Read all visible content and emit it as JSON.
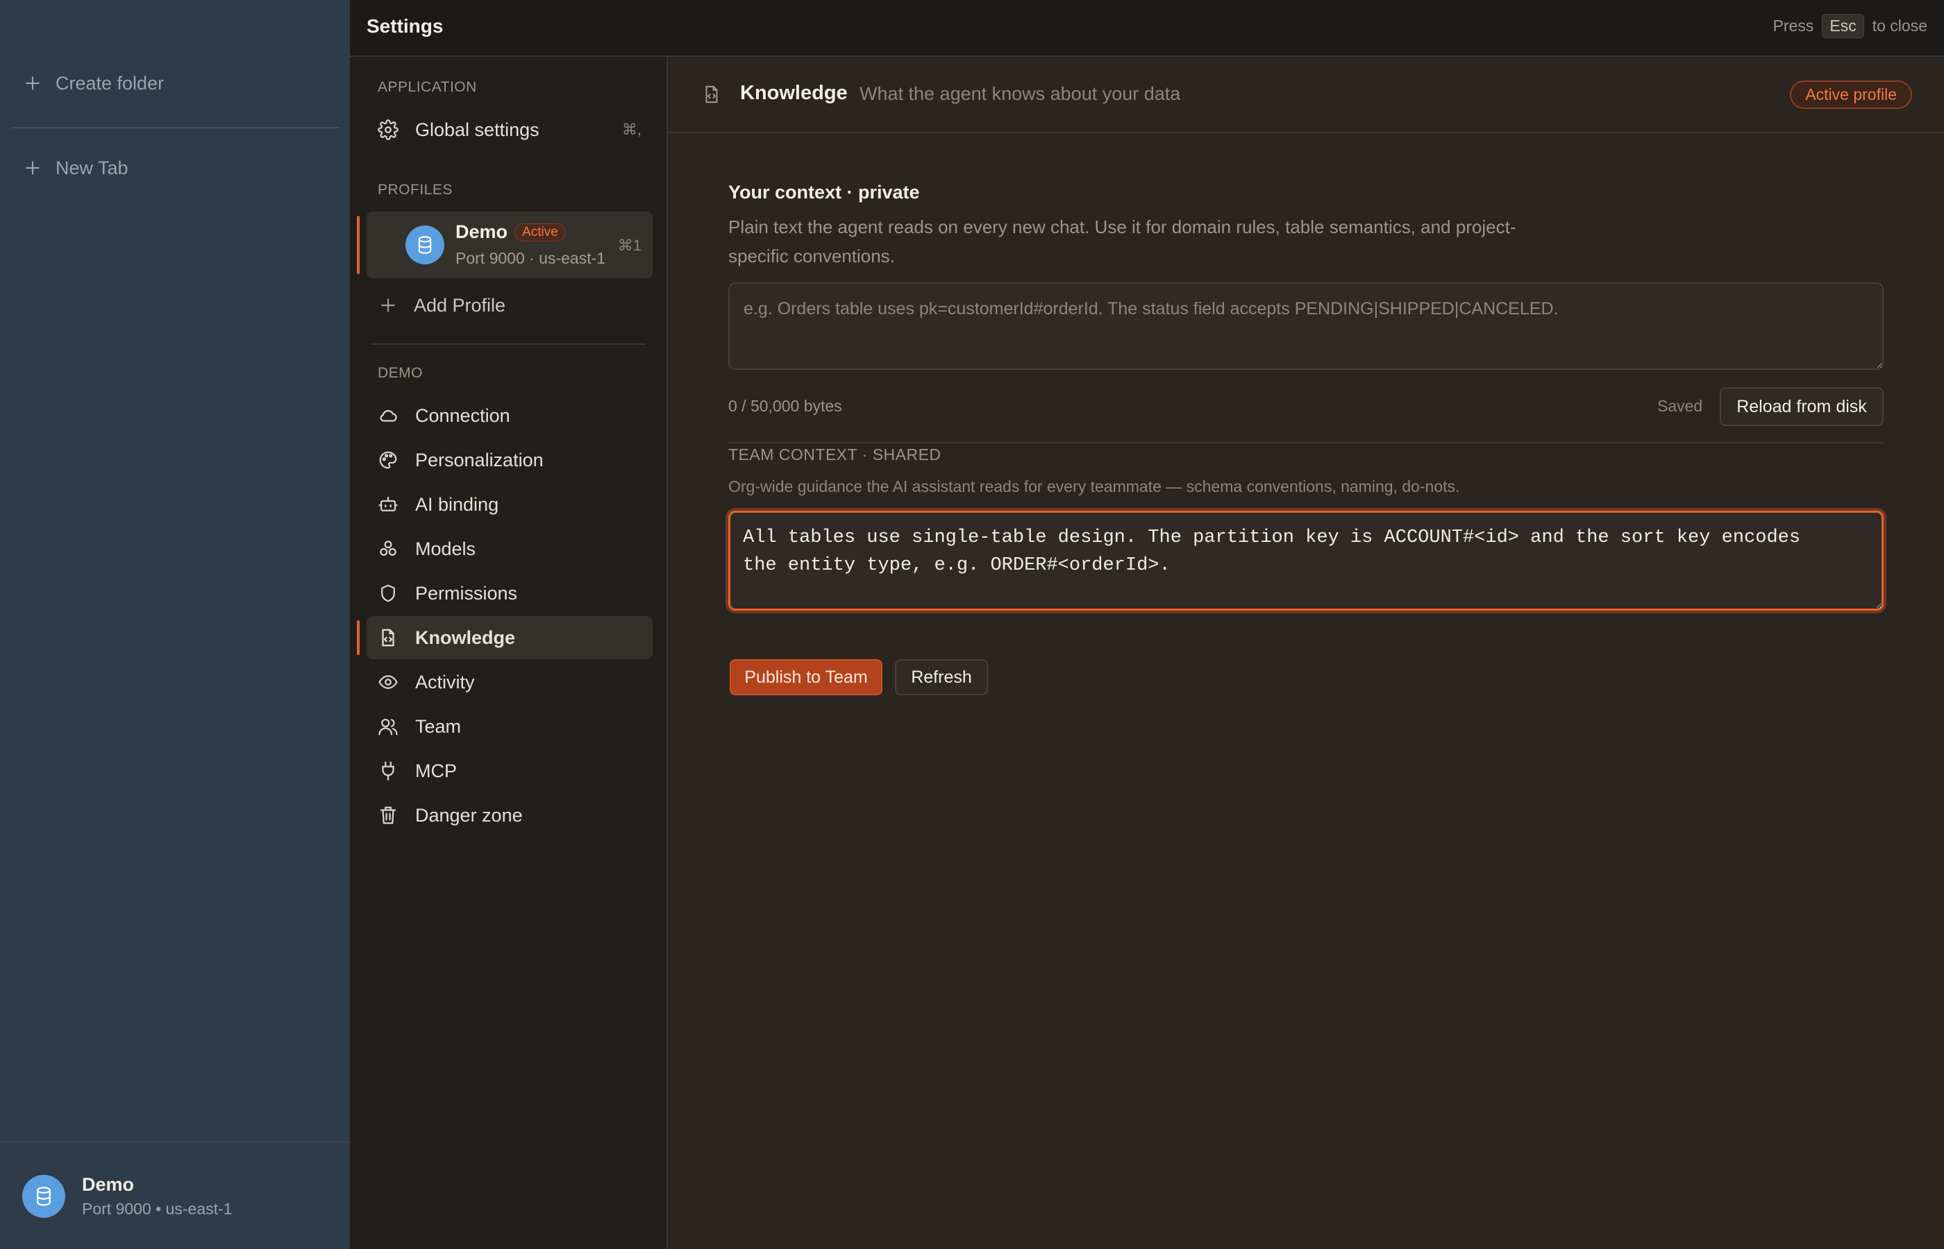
{
  "app_sidebar": {
    "create_folder": "Create folder",
    "new_tab": "New Tab",
    "profile": {
      "name": "Demo",
      "meta": "Port 9000 • us-east-1"
    }
  },
  "top_bar": {
    "title": "Settings",
    "esc_hint": {
      "press": "Press",
      "key": "Esc",
      "suffix": "to close"
    }
  },
  "nav": {
    "application_header": "APPLICATION",
    "global_settings": {
      "label": "Global settings",
      "shortcut": "⌘,"
    },
    "profiles_header": "PROFILES",
    "profile_demo": {
      "name": "Demo",
      "badge": "Active",
      "meta": "Port 9000 · us-east-1",
      "shortcut": "⌘1"
    },
    "add_profile": "Add Profile",
    "demo_header": "DEMO",
    "items": [
      {
        "label": "Connection",
        "icon": "cloud-icon"
      },
      {
        "label": "Personalization",
        "icon": "palette-icon"
      },
      {
        "label": "AI binding",
        "icon": "bot-icon"
      },
      {
        "label": "Models",
        "icon": "models-icon"
      },
      {
        "label": "Permissions",
        "icon": "shield-icon"
      },
      {
        "label": "Knowledge",
        "icon": "file-code-icon",
        "active": true
      },
      {
        "label": "Activity",
        "icon": "eye-icon"
      },
      {
        "label": "Team",
        "icon": "users-icon"
      },
      {
        "label": "MCP",
        "icon": "plug-icon"
      },
      {
        "label": "Danger zone",
        "icon": "trash-icon"
      }
    ]
  },
  "main": {
    "title": "Knowledge",
    "subtitle": "What the agent knows about your data",
    "active_badge": "Active profile",
    "private_context": {
      "label": "Your context · private",
      "description_line1": "Plain text the agent reads on every new chat. Use it for domain rules, table semantics, and project-",
      "description_line2": "specific conventions.",
      "placeholder": "e.g. Orders table uses pk=customerId#orderId. The status field accepts PENDING|SHIPPED|CANCELED.",
      "value": "",
      "bytes": "0 / 50,000 bytes",
      "status": "Saved",
      "reload_label": "Reload from disk"
    },
    "team_context": {
      "label": "TEAM CONTEXT · SHARED",
      "description": "Org-wide guidance the AI assistant reads for every teammate — schema conventions, naming, do-nots.",
      "value": "All tables use single-table design. The partition key is ACCOUNT#<id> and the sort key encodes\nthe entity type, e.g. ORDER#<orderId>.\n\nAmounts are stored in minor units (cents). Timestamps are epoch seconds.",
      "publish_label": "Publish to Team",
      "refresh_label": "Refresh"
    }
  },
  "colors": {
    "accent": "#e8622c",
    "sidebar_bg": "#2e3b48",
    "avatar": "#5b9ee0",
    "panel_bg": "#2a2520"
  }
}
